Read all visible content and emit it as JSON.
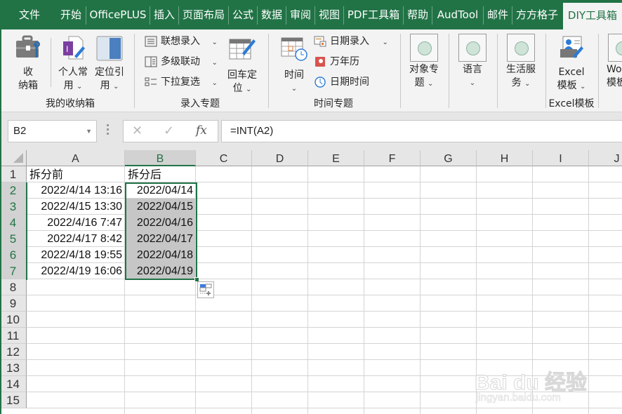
{
  "tabs": [
    {
      "label": "文件"
    },
    {
      "label": "开始"
    },
    {
      "label": "OfficePLUS"
    },
    {
      "label": "插入"
    },
    {
      "label": "页面布局"
    },
    {
      "label": "公式"
    },
    {
      "label": "数据"
    },
    {
      "label": "审阅"
    },
    {
      "label": "视图"
    },
    {
      "label": "PDF工具箱"
    },
    {
      "label": "帮助"
    },
    {
      "label": "AudTool"
    },
    {
      "label": "邮件"
    },
    {
      "label": "方方格子"
    },
    {
      "label": "DIY工具箱",
      "active": true
    }
  ],
  "ribbon": {
    "groups": {
      "storage": {
        "label": "我的收纳箱",
        "btn_storage": [
          "收",
          "纳箱"
        ],
        "btn_personal": [
          "个人常",
          "用"
        ],
        "btn_locate": [
          "定位引",
          "用"
        ]
      },
      "input": {
        "label": "录入专题",
        "assoc": "联想录入",
        "multilevel": "多级联动",
        "dropdown": "下拉复选",
        "enter_pos": [
          "回车定",
          "位"
        ]
      },
      "time": {
        "label": "时间专题",
        "time_btn": "时间",
        "date_input": "日期录入",
        "calendar": "万年历",
        "datetime": "日期时间"
      },
      "object": {
        "label": [
          "对象专",
          "题"
        ]
      },
      "lang": {
        "label": "语言"
      },
      "life": {
        "label": [
          "生活服",
          "务"
        ]
      },
      "excel_tpl": {
        "label": "Excel模板",
        "btn": [
          "Excel",
          "模板"
        ]
      },
      "word_tpl": {
        "btn": [
          "Wo",
          "模板"
        ]
      }
    }
  },
  "formula_bar": {
    "name_box": "B2",
    "cancel": "✕",
    "enter": "✓",
    "fx": "fx",
    "formula": "=INT(A2)"
  },
  "sheet": {
    "columns": [
      "A",
      "B",
      "C",
      "D",
      "E",
      "F",
      "G",
      "H",
      "I",
      "J"
    ],
    "rows": [
      "1",
      "2",
      "3",
      "4",
      "5",
      "6",
      "7",
      "8",
      "9",
      "10",
      "11",
      "12",
      "13",
      "14",
      "15"
    ],
    "header_a": "拆分前",
    "header_b": "拆分后",
    "col_a": [
      "2022/4/14 13:16",
      "2022/4/15 13:30",
      "2022/4/16 7:47",
      "2022/4/17 8:42",
      "2022/4/18 19:55",
      "2022/4/19 16:06"
    ],
    "col_b": [
      "2022/04/14",
      "2022/04/15",
      "2022/04/16",
      "2022/04/17",
      "2022/04/18",
      "2022/04/19"
    ],
    "selected_range": "B2:B7",
    "active_cell": "B2"
  },
  "colors": {
    "accent": "#217346",
    "selection_fill": "#c6c6c6"
  },
  "watermark": {
    "line1": "Bai du 经验",
    "line2": "jingyan.baidu.com"
  }
}
